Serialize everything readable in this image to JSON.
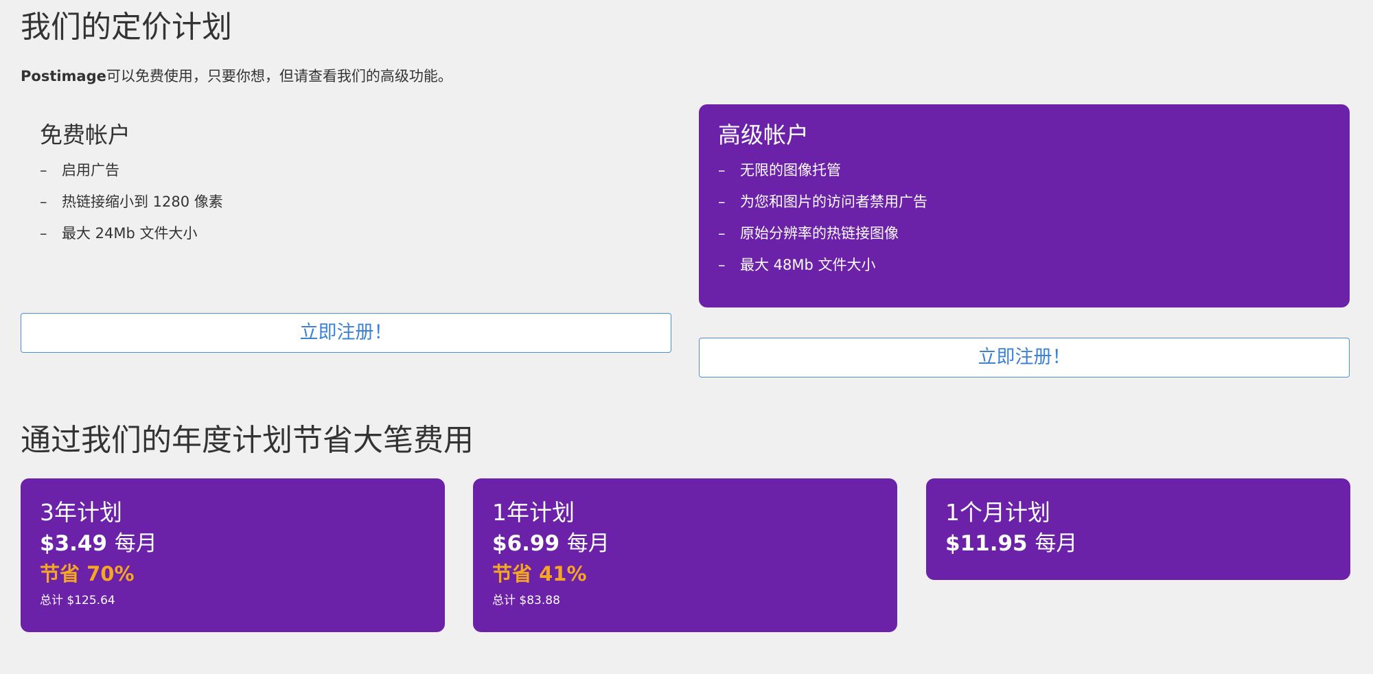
{
  "header": {
    "title": "我们的定价计划",
    "intro_brand": "Postimage",
    "intro_text": "可以免费使用，只要你想，但请查看我们的高级功能。"
  },
  "free_plan": {
    "title": "免费帐户",
    "features": [
      "启用广告",
      "热链接缩小到 1280 像素",
      "最大 24Mb 文件大小"
    ],
    "button_label": "立即注册！"
  },
  "premium_plan": {
    "title": "高级帐户",
    "features": [
      "无限的图像托管",
      "为您和图片的访问者禁用广告",
      "原始分辨率的热链接图像",
      "最大 48Mb 文件大小"
    ],
    "button_label": "立即注册！"
  },
  "annual": {
    "title": "通过我们的年度计划节省大笔费用",
    "plans": [
      {
        "name": "3年计划",
        "price": "$3.49",
        "per": "每月",
        "save": "节省 70%",
        "total": "总计 $125.64"
      },
      {
        "name": "1年计划",
        "price": "$6.99",
        "per": "每月",
        "save": "节省 41%",
        "total": "总计 $83.88"
      },
      {
        "name": "1个月计划",
        "price": "$11.95",
        "per": "每月"
      }
    ]
  },
  "colors": {
    "background": "#f0f0f0",
    "premium_purple": "#6b21a8",
    "save_orange": "#f5a623",
    "button_blue": "#3b82d6",
    "text_dark": "#333333"
  },
  "icons": {
    "feature_bullet": "dash"
  }
}
